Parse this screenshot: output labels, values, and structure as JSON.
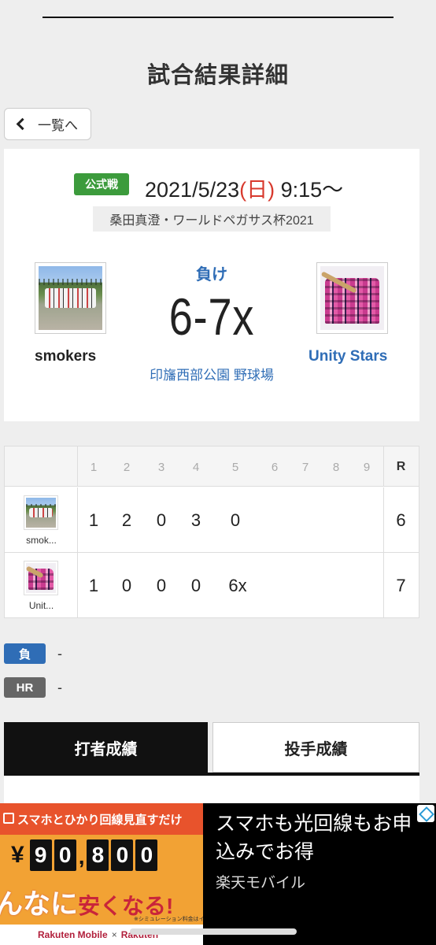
{
  "page": {
    "title": "試合結果詳細"
  },
  "nav": {
    "back_label": "一覧へ"
  },
  "match": {
    "game_type": "公式戦",
    "date": "2021/5/23",
    "dow": "(日)",
    "time": "9:15〜",
    "tournament": "桑田真澄・ワールドペガサス杯2021",
    "result": "負け",
    "score": "6-7x",
    "venue": "印旛西部公園 野球場",
    "home_team": "smokers",
    "away_team": "Unity Stars"
  },
  "linescore": {
    "innings": [
      "1",
      "2",
      "3",
      "4",
      "5",
      "6",
      "7",
      "8",
      "9"
    ],
    "r_header": "R",
    "rows": [
      {
        "abbr": "smok...",
        "scores": [
          "1",
          "2",
          "0",
          "3",
          "0",
          "",
          "",
          "",
          ""
        ],
        "r": "6"
      },
      {
        "abbr": "Unit...",
        "scores": [
          "1",
          "0",
          "0",
          "0",
          "6x",
          "",
          "",
          "",
          ""
        ],
        "r": "7"
      }
    ]
  },
  "stats": {
    "lose_label": "負",
    "lose_value": "-",
    "hr_label": "HR",
    "hr_value": "-"
  },
  "tabs": {
    "batting": "打者成績",
    "pitching": "投手成績"
  },
  "ad": {
    "top_text": "スマホとひかり回線見直すだけ",
    "yen": "¥",
    "digits": [
      "9",
      "0",
      "8",
      "0",
      "0"
    ],
    "slogan_a": "んなに",
    "slogan_b": "安くなる!",
    "note": "※シミュレーション料金はイメ",
    "brand_a": "Rakuten Mobile",
    "brand_x": "×",
    "brand_b": "Rakuten",
    "headline": "スマホも光回線もお申込みでお得",
    "brand_name": "楽天モバイル"
  },
  "colors": {
    "accent_blue": "#2f6db6",
    "official_green": "#3c9b3c",
    "sunday_red": "#d83a2e"
  }
}
